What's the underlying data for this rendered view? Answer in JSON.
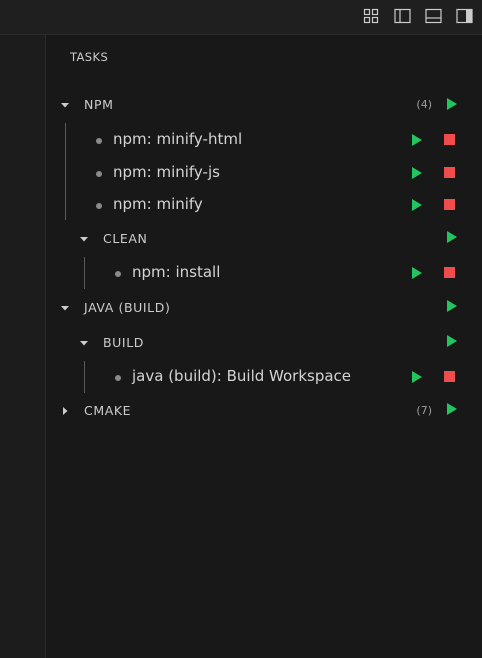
{
  "colors": {
    "background": "#181818",
    "titlebar": "#1f1f1f",
    "run_green": "#23c55e",
    "stop_red": "#f14c4c"
  },
  "titlebar": {
    "icons": [
      "layout-grid-icon",
      "toggle-primary-sidebar-icon",
      "toggle-panel-icon",
      "toggle-secondary-sidebar-icon"
    ]
  },
  "panel": {
    "title": "TASKS",
    "groups": {
      "npm": {
        "label": "NPM",
        "count": "(4)",
        "expanded": true
      },
      "clean": {
        "label": "CLEAN",
        "expanded": true
      },
      "java": {
        "label": "JAVA (BUILD)",
        "expanded": true
      },
      "build": {
        "label": "BUILD",
        "expanded": true
      },
      "cmake": {
        "label": "CMAKE",
        "count": "(7)",
        "expanded": false
      }
    },
    "tasks": {
      "minify_html": "npm: minify-html",
      "minify_js": "npm: minify-js",
      "minify": "npm: minify",
      "install": "npm: install",
      "build_workspace": "java (build): Build Workspace"
    }
  }
}
